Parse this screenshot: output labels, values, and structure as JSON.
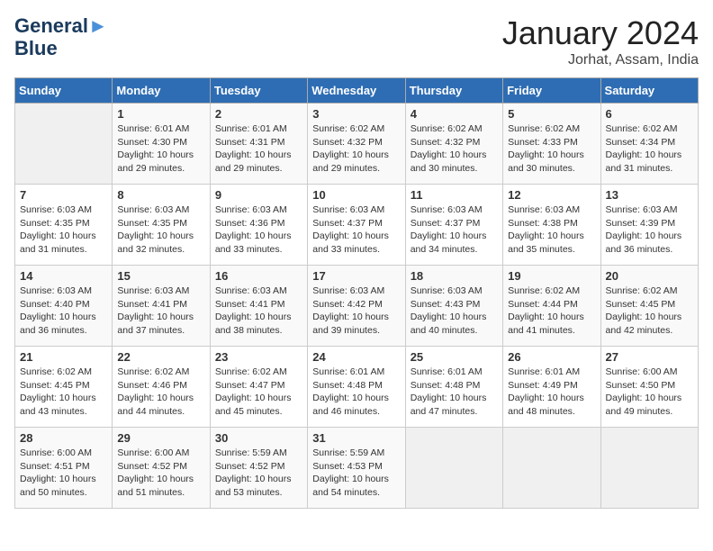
{
  "header": {
    "logo_line1": "General",
    "logo_line2": "Blue",
    "month": "January 2024",
    "location": "Jorhat, Assam, India"
  },
  "days_of_week": [
    "Sunday",
    "Monday",
    "Tuesday",
    "Wednesday",
    "Thursday",
    "Friday",
    "Saturday"
  ],
  "weeks": [
    [
      {
        "day": "",
        "info": ""
      },
      {
        "day": "1",
        "info": "Sunrise: 6:01 AM\nSunset: 4:30 PM\nDaylight: 10 hours\nand 29 minutes."
      },
      {
        "day": "2",
        "info": "Sunrise: 6:01 AM\nSunset: 4:31 PM\nDaylight: 10 hours\nand 29 minutes."
      },
      {
        "day": "3",
        "info": "Sunrise: 6:02 AM\nSunset: 4:32 PM\nDaylight: 10 hours\nand 29 minutes."
      },
      {
        "day": "4",
        "info": "Sunrise: 6:02 AM\nSunset: 4:32 PM\nDaylight: 10 hours\nand 30 minutes."
      },
      {
        "day": "5",
        "info": "Sunrise: 6:02 AM\nSunset: 4:33 PM\nDaylight: 10 hours\nand 30 minutes."
      },
      {
        "day": "6",
        "info": "Sunrise: 6:02 AM\nSunset: 4:34 PM\nDaylight: 10 hours\nand 31 minutes."
      }
    ],
    [
      {
        "day": "7",
        "info": "Sunrise: 6:03 AM\nSunset: 4:35 PM\nDaylight: 10 hours\nand 31 minutes."
      },
      {
        "day": "8",
        "info": "Sunrise: 6:03 AM\nSunset: 4:35 PM\nDaylight: 10 hours\nand 32 minutes."
      },
      {
        "day": "9",
        "info": "Sunrise: 6:03 AM\nSunset: 4:36 PM\nDaylight: 10 hours\nand 33 minutes."
      },
      {
        "day": "10",
        "info": "Sunrise: 6:03 AM\nSunset: 4:37 PM\nDaylight: 10 hours\nand 33 minutes."
      },
      {
        "day": "11",
        "info": "Sunrise: 6:03 AM\nSunset: 4:37 PM\nDaylight: 10 hours\nand 34 minutes."
      },
      {
        "day": "12",
        "info": "Sunrise: 6:03 AM\nSunset: 4:38 PM\nDaylight: 10 hours\nand 35 minutes."
      },
      {
        "day": "13",
        "info": "Sunrise: 6:03 AM\nSunset: 4:39 PM\nDaylight: 10 hours\nand 36 minutes."
      }
    ],
    [
      {
        "day": "14",
        "info": "Sunrise: 6:03 AM\nSunset: 4:40 PM\nDaylight: 10 hours\nand 36 minutes."
      },
      {
        "day": "15",
        "info": "Sunrise: 6:03 AM\nSunset: 4:41 PM\nDaylight: 10 hours\nand 37 minutes."
      },
      {
        "day": "16",
        "info": "Sunrise: 6:03 AM\nSunset: 4:41 PM\nDaylight: 10 hours\nand 38 minutes."
      },
      {
        "day": "17",
        "info": "Sunrise: 6:03 AM\nSunset: 4:42 PM\nDaylight: 10 hours\nand 39 minutes."
      },
      {
        "day": "18",
        "info": "Sunrise: 6:03 AM\nSunset: 4:43 PM\nDaylight: 10 hours\nand 40 minutes."
      },
      {
        "day": "19",
        "info": "Sunrise: 6:02 AM\nSunset: 4:44 PM\nDaylight: 10 hours\nand 41 minutes."
      },
      {
        "day": "20",
        "info": "Sunrise: 6:02 AM\nSunset: 4:45 PM\nDaylight: 10 hours\nand 42 minutes."
      }
    ],
    [
      {
        "day": "21",
        "info": "Sunrise: 6:02 AM\nSunset: 4:45 PM\nDaylight: 10 hours\nand 43 minutes."
      },
      {
        "day": "22",
        "info": "Sunrise: 6:02 AM\nSunset: 4:46 PM\nDaylight: 10 hours\nand 44 minutes."
      },
      {
        "day": "23",
        "info": "Sunrise: 6:02 AM\nSunset: 4:47 PM\nDaylight: 10 hours\nand 45 minutes."
      },
      {
        "day": "24",
        "info": "Sunrise: 6:01 AM\nSunset: 4:48 PM\nDaylight: 10 hours\nand 46 minutes."
      },
      {
        "day": "25",
        "info": "Sunrise: 6:01 AM\nSunset: 4:48 PM\nDaylight: 10 hours\nand 47 minutes."
      },
      {
        "day": "26",
        "info": "Sunrise: 6:01 AM\nSunset: 4:49 PM\nDaylight: 10 hours\nand 48 minutes."
      },
      {
        "day": "27",
        "info": "Sunrise: 6:00 AM\nSunset: 4:50 PM\nDaylight: 10 hours\nand 49 minutes."
      }
    ],
    [
      {
        "day": "28",
        "info": "Sunrise: 6:00 AM\nSunset: 4:51 PM\nDaylight: 10 hours\nand 50 minutes."
      },
      {
        "day": "29",
        "info": "Sunrise: 6:00 AM\nSunset: 4:52 PM\nDaylight: 10 hours\nand 51 minutes."
      },
      {
        "day": "30",
        "info": "Sunrise: 5:59 AM\nSunset: 4:52 PM\nDaylight: 10 hours\nand 53 minutes."
      },
      {
        "day": "31",
        "info": "Sunrise: 5:59 AM\nSunset: 4:53 PM\nDaylight: 10 hours\nand 54 minutes."
      },
      {
        "day": "",
        "info": ""
      },
      {
        "day": "",
        "info": ""
      },
      {
        "day": "",
        "info": ""
      }
    ]
  ]
}
